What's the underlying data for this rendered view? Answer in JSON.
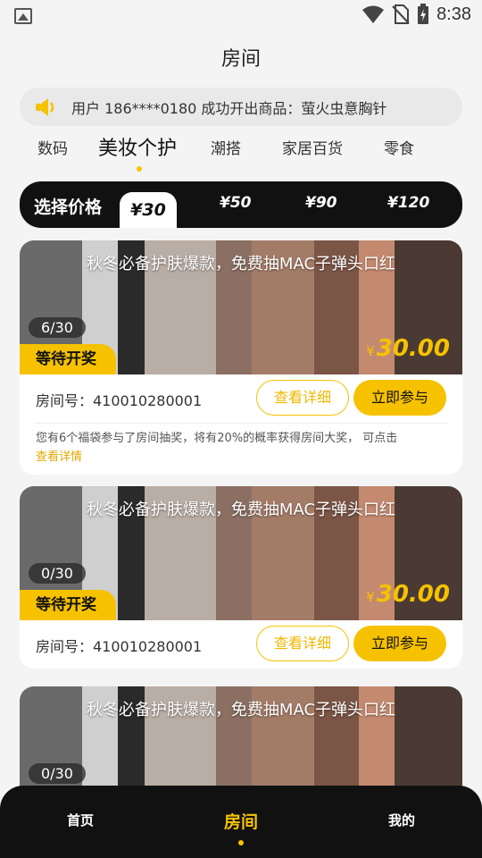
{
  "status_bar": {
    "time": "8:38",
    "icons": [
      "image-icon",
      "wifi-icon",
      "no-sim-icon",
      "battery-icon"
    ]
  },
  "header": {
    "title": "房间"
  },
  "notice": {
    "icon": "speaker-icon",
    "text": "用户 186****0180 成功开出商品：萤火虫意胸针"
  },
  "categories": [
    {
      "label": "数码",
      "active": false
    },
    {
      "label": "美妆个护",
      "active": true
    },
    {
      "label": "潮搭",
      "active": false
    },
    {
      "label": "家居百货",
      "active": false
    },
    {
      "label": "零食",
      "active": false
    }
  ],
  "price_filter": {
    "label": "选择价格",
    "options": [
      "¥30",
      "¥50",
      "¥90",
      "¥120"
    ],
    "selected": "¥30"
  },
  "rooms": [
    {
      "title": "秋冬必备护肤爆款，免费抽MAC子弹头口红",
      "count": "6/30",
      "status": "等待开奖",
      "currency": "¥",
      "price": "30.00",
      "room_no": "房间号：410010280001",
      "detail_label": "查看详细",
      "join_label": "立即参与",
      "note": "您有6个福袋参与了房间抽奖，将有20%的概率获得房间大奖， 可点击",
      "note_link": "查看详情"
    },
    {
      "title": "秋冬必备护肤爆款，免费抽MAC子弹头口红",
      "count": "0/30",
      "status": "等待开奖",
      "currency": "¥",
      "price": "30.00",
      "room_no": "房间号：410010280001",
      "detail_label": "查看详细",
      "join_label": "立即参与"
    },
    {
      "title": "秋冬必备护肤爆款，免费抽MAC子弹头口红",
      "count": "0/30"
    }
  ],
  "bottom_nav": [
    {
      "label": "首页",
      "active": false
    },
    {
      "label": "房间",
      "active": true
    },
    {
      "label": "我的",
      "active": false
    }
  ],
  "colors": {
    "accent": "#f6c200",
    "dark": "#111111",
    "background": "#f4f4f4"
  }
}
